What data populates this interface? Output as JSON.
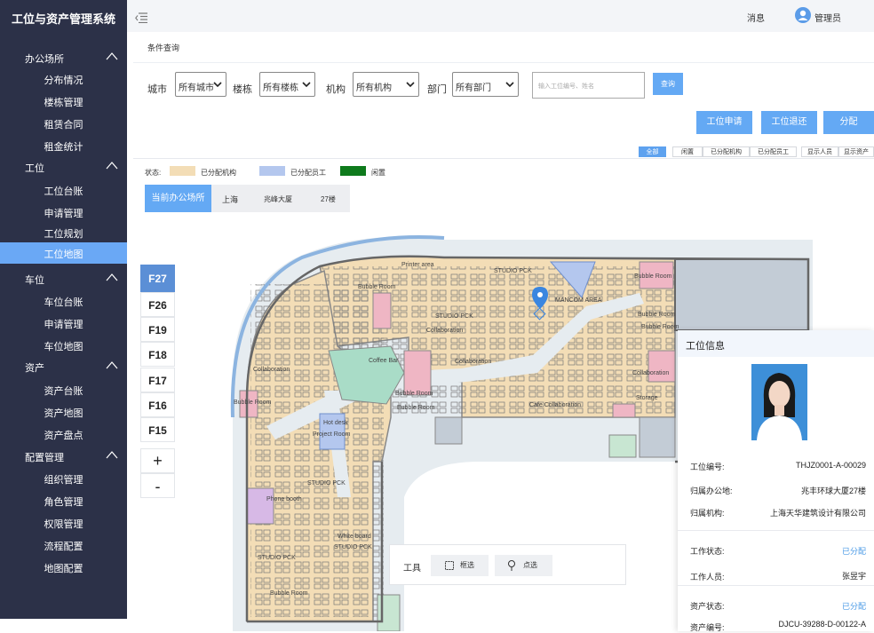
{
  "app": {
    "title": "工位与资产管理系统"
  },
  "sidebar": {
    "groups": [
      {
        "label": "办公场所",
        "items": [
          "分布情况",
          "楼栋管理",
          "租赁合同",
          "租金统计"
        ]
      },
      {
        "label": "工位",
        "items": [
          "工位台账",
          "申请管理",
          "工位规划",
          "工位地图"
        ]
      },
      {
        "label": "车位",
        "items": [
          "车位台账",
          "申请管理",
          "车位地图"
        ]
      },
      {
        "label": "资产",
        "items": [
          "资产台账",
          "资产地图",
          "资产盘点"
        ]
      },
      {
        "label": "配置管理",
        "items": [
          "组织管理",
          "角色管理",
          "权限管理",
          "流程配置",
          "地图配置"
        ]
      }
    ],
    "active_item": "工位地图"
  },
  "header": {
    "messages": "消息",
    "user": "管理员"
  },
  "breadcrumb": "条件查询",
  "filters": {
    "city_label": "城市",
    "city_value": "所有城市",
    "building_label": "楼栋",
    "building_value": "所有楼栋",
    "org_label": "机构",
    "org_value": "所有机构",
    "dept_label": "部门",
    "dept_value": "所有部门",
    "search_placeholder": "输入工位编号、姓名",
    "search_button": "查询"
  },
  "actions": {
    "apply": "工位申请",
    "return": "工位退还",
    "assign": "分配"
  },
  "status_tabs": [
    "全部",
    "闲置",
    "已分配机构",
    "已分配员工",
    "显示人员",
    "显示资产"
  ],
  "legend": {
    "label": "状态:",
    "items": [
      {
        "label": "已分配机构",
        "color": "#f3ddb6"
      },
      {
        "label": "已分配员工",
        "color": "#b4c7ee"
      },
      {
        "label": "闲置",
        "color": "#0e7a1c"
      }
    ]
  },
  "location": {
    "current": "当前办公场所",
    "city": "上海",
    "building": "兆峰大厦",
    "floor": "27楼"
  },
  "floors": [
    "F27",
    "F26",
    "F19",
    "F18",
    "F17",
    "F16",
    "F15"
  ],
  "active_floor": "F27",
  "zoom": {
    "in": "+",
    "out": "-"
  },
  "map_labels": {
    "printer": "Printer area",
    "studio1": "STUDIO PCK",
    "studio2": "STUDIO PCK",
    "mancom": "MANCOM AREA",
    "bubble1": "Bubble Room",
    "bubble2": "Bubble Room",
    "bubble3": "Bubble Room",
    "bubble4": "Bubble Room",
    "bubble5": "Bubble Room",
    "bubble6": "Bubble Room",
    "bubble7": "Bubble Room",
    "bubble8": "Bubble Room",
    "collab1": "Collaboration",
    "collab2": "Collaboration",
    "collab3": "Collaboration",
    "collab4": "Collaboration",
    "coffee": "Coffee Bar",
    "cafe": "Cafe Collaboration",
    "storage": "Storage",
    "hotdesk": "Hot desk",
    "project": "Project Room",
    "phone": "Phone booth",
    "whiteboard": "White board",
    "studio3": "STUDIO PCK",
    "studio4": "STUDIO PCK",
    "studio5": "STUDIO PCK"
  },
  "tools": {
    "label": "工具",
    "box_select": "框选",
    "point_select": "点选"
  },
  "info_panel": {
    "title": "工位信息",
    "rows": [
      {
        "k": "工位编号:",
        "v": "THJZ0001-A-00029"
      },
      {
        "k": "归属办公地:",
        "v": "兆丰环球大厦27楼"
      },
      {
        "k": "归属机构:",
        "v": "上海天华建筑设计有限公司"
      },
      {
        "k": "工作状态:",
        "v": "已分配"
      },
      {
        "k": "工作人员:",
        "v": "张昱宇"
      },
      {
        "k": "资产状态:",
        "v": "已分配"
      },
      {
        "k": "资产编号:",
        "v": "DJCU-39288-D-00122-A"
      }
    ]
  }
}
